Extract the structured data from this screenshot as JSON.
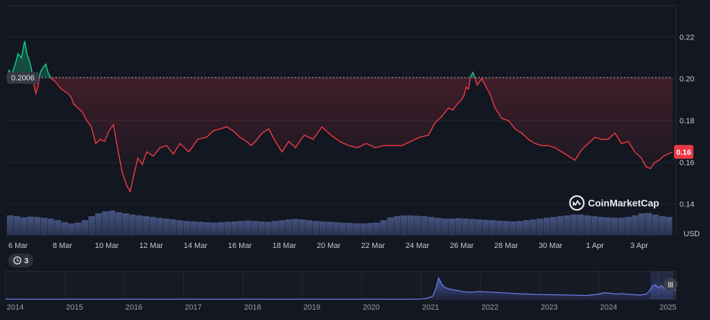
{
  "chart_data": [
    {
      "type": "line",
      "title": "",
      "currency_label": "USD",
      "y_ticks": [
        "0.22",
        "0.20",
        "0.18",
        "0.16",
        "0.14"
      ],
      "ylim": [
        0.125,
        0.235
      ],
      "x_ticks": [
        "6 Mar",
        "8 Mar",
        "10 Mar",
        "12 Mar",
        "14 Mar",
        "16 Mar",
        "18 Mar",
        "20 Mar",
        "22 Mar",
        "24 Mar",
        "26 Mar",
        "28 Mar",
        "30 Mar",
        "1 Apr",
        "3 Apr"
      ],
      "x_range_days": [
        0,
        30
      ],
      "reference_value": 0.2006,
      "reference_label": "0.2006",
      "current_value": 0.165,
      "current_label": "0.16",
      "colors": {
        "above": "#16c784",
        "below": "#ea3943",
        "volume": "#3a4870",
        "badge": "#ea3943"
      },
      "series": [
        {
          "x": [
            0,
            0.1,
            0.2,
            0.35,
            0.5,
            0.65,
            0.8,
            0.9,
            1.0,
            1.1,
            1.2,
            1.3,
            1.4,
            1.5,
            1.6,
            1.75,
            1.85,
            2.0,
            2.15,
            2.3,
            2.45,
            2.6,
            2.75,
            2.9,
            3.0,
            3.2,
            3.4,
            3.6,
            3.8,
            4.0,
            4.2,
            4.4,
            4.6,
            4.8,
            5.0,
            5.2,
            5.4,
            5.55,
            5.7,
            5.9,
            6.1,
            6.3,
            6.6,
            6.9,
            7.2,
            7.5,
            7.8,
            8.2,
            8.6,
            9.0,
            9.3,
            9.6,
            9.9,
            10.2,
            10.5,
            10.8,
            11.0,
            11.2,
            11.5,
            11.8,
            12.1,
            12.4,
            12.7,
            13.0,
            13.4,
            13.8,
            14.2,
            14.6,
            15.0,
            15.4,
            15.8,
            16.2,
            16.6,
            17.0,
            17.4,
            17.8,
            18.2,
            18.6,
            19.0,
            19.3,
            19.6,
            19.9,
            20.1,
            20.3,
            20.5,
            20.6,
            20.7,
            20.8,
            20.9,
            21.0,
            21.2,
            21.4,
            21.6,
            21.8,
            22.0,
            22.3,
            22.6,
            22.9,
            23.2,
            23.5,
            23.8,
            24.1,
            24.4,
            24.7,
            25.0,
            25.3,
            25.6,
            25.9,
            26.2,
            26.5,
            26.8,
            27.1,
            27.4,
            27.7,
            28.0,
            28.3,
            28.6,
            28.8,
            29.0,
            29.2,
            29.4,
            29.6,
            29.8,
            30.0
          ],
          "y": [
            0.2006,
            0.204,
            0.202,
            0.206,
            0.212,
            0.21,
            0.218,
            0.212,
            0.209,
            0.205,
            0.198,
            0.193,
            0.196,
            0.203,
            0.205,
            0.207,
            0.203,
            0.2,
            0.199,
            0.197,
            0.195,
            0.194,
            0.193,
            0.191,
            0.188,
            0.186,
            0.184,
            0.18,
            0.177,
            0.169,
            0.171,
            0.17,
            0.175,
            0.178,
            0.166,
            0.155,
            0.149,
            0.146,
            0.153,
            0.162,
            0.159,
            0.165,
            0.163,
            0.167,
            0.168,
            0.164,
            0.169,
            0.165,
            0.171,
            0.172,
            0.175,
            0.176,
            0.177,
            0.175,
            0.172,
            0.17,
            0.168,
            0.17,
            0.174,
            0.176,
            0.17,
            0.165,
            0.17,
            0.167,
            0.173,
            0.171,
            0.177,
            0.173,
            0.17,
            0.168,
            0.167,
            0.169,
            0.167,
            0.168,
            0.168,
            0.168,
            0.17,
            0.172,
            0.173,
            0.179,
            0.182,
            0.186,
            0.185,
            0.188,
            0.19,
            0.192,
            0.196,
            0.195,
            0.201,
            0.203,
            0.197,
            0.2,
            0.196,
            0.192,
            0.186,
            0.181,
            0.18,
            0.176,
            0.174,
            0.171,
            0.169,
            0.168,
            0.168,
            0.167,
            0.165,
            0.163,
            0.161,
            0.166,
            0.169,
            0.172,
            0.171,
            0.171,
            0.174,
            0.169,
            0.17,
            0.165,
            0.162,
            0.158,
            0.157,
            0.16,
            0.161,
            0.163,
            0.164,
            0.165
          ]
        }
      ],
      "volume": [
        0.5,
        0.48,
        0.45,
        0.47,
        0.46,
        0.44,
        0.42,
        0.38,
        0.33,
        0.3,
        0.32,
        0.38,
        0.48,
        0.55,
        0.6,
        0.62,
        0.58,
        0.55,
        0.52,
        0.5,
        0.48,
        0.46,
        0.44,
        0.42,
        0.4,
        0.38,
        0.36,
        0.35,
        0.34,
        0.33,
        0.32,
        0.33,
        0.34,
        0.35,
        0.36,
        0.37,
        0.36,
        0.35,
        0.34,
        0.36,
        0.38,
        0.4,
        0.41,
        0.4,
        0.38,
        0.36,
        0.35,
        0.34,
        0.33,
        0.32,
        0.31,
        0.3,
        0.3,
        0.31,
        0.32,
        0.38,
        0.45,
        0.48,
        0.5,
        0.5,
        0.49,
        0.48,
        0.46,
        0.44,
        0.42,
        0.42,
        0.43,
        0.42,
        0.41,
        0.4,
        0.39,
        0.38,
        0.37,
        0.36,
        0.35,
        0.36,
        0.38,
        0.4,
        0.42,
        0.44,
        0.46,
        0.48,
        0.5,
        0.52,
        0.52,
        0.5,
        0.48,
        0.46,
        0.45,
        0.44,
        0.44,
        0.46,
        0.5,
        0.55,
        0.56,
        0.52,
        0.48,
        0.46
      ]
    },
    {
      "type": "area",
      "title": "",
      "x_ticks": [
        "2014",
        "2015",
        "2016",
        "2017",
        "2018",
        "2019",
        "2020",
        "2021",
        "2022",
        "2023",
        "2024",
        "2025"
      ],
      "x_range": [
        2014,
        2025.3
      ],
      "ylim": [
        0,
        1
      ],
      "series": [
        {
          "x": [
            2014,
            2020.9,
            2021.0,
            2021.1,
            2021.2,
            2021.25,
            2021.3,
            2021.35,
            2021.4,
            2021.5,
            2021.6,
            2021.7,
            2021.8,
            2021.9,
            2022.0,
            2022.2,
            2022.4,
            2022.6,
            2022.8,
            2023.0,
            2023.2,
            2023.4,
            2023.6,
            2023.8,
            2024.0,
            2024.1,
            2024.2,
            2024.3,
            2024.4,
            2024.5,
            2024.6,
            2024.7,
            2024.8,
            2024.85,
            2024.9,
            2024.95,
            2025.0,
            2025.05,
            2025.1,
            2025.2,
            2025.3
          ],
          "y": [
            0,
            0,
            0.01,
            0.04,
            0.12,
            0.45,
            0.9,
            0.65,
            0.5,
            0.42,
            0.38,
            0.33,
            0.3,
            0.31,
            0.33,
            0.3,
            0.27,
            0.24,
            0.22,
            0.2,
            0.19,
            0.18,
            0.17,
            0.16,
            0.22,
            0.28,
            0.25,
            0.22,
            0.24,
            0.21,
            0.19,
            0.18,
            0.22,
            0.35,
            0.55,
            0.62,
            0.5,
            0.58,
            0.45,
            0.4,
            0.38
          ]
        }
      ]
    }
  ],
  "watermark": {
    "icon": "coinmarketcap-logo",
    "text": "CoinMarketCap"
  },
  "events_badge": {
    "icon": "history-icon",
    "count": "3"
  },
  "handle_icon": "drag-handle-icon"
}
